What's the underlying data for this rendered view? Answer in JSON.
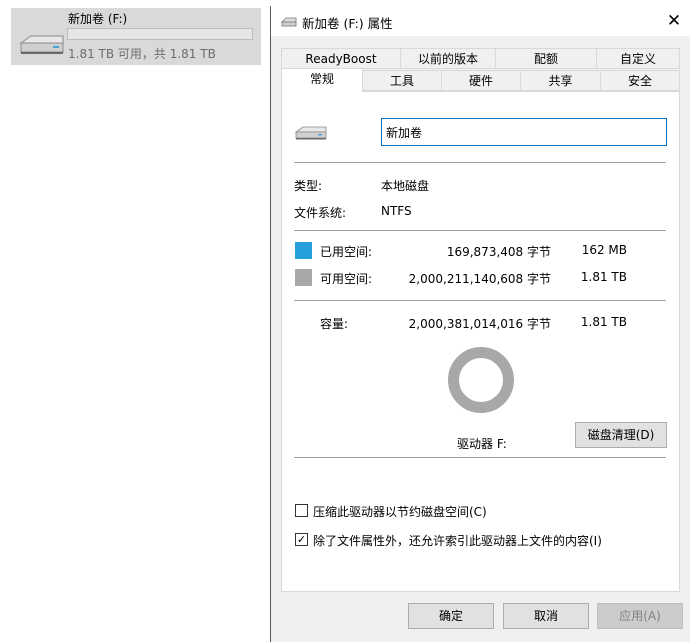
{
  "explorer": {
    "drive_name": "新加卷 (F:)",
    "drive_space": "1.81 TB 可用，共 1.81 TB",
    "usage_fraction": 0.0001
  },
  "dialog": {
    "title": "新加卷 (F:) 属性",
    "close_glyph": "✕",
    "tabs_row1": [
      "ReadyBoost",
      "以前的版本",
      "配额",
      "自定义"
    ],
    "tabs_row2": [
      "常规",
      "工具",
      "硬件",
      "共享",
      "安全"
    ],
    "active_tab": "常规",
    "volume_name_value": "新加卷",
    "type_label": "类型:",
    "type_value": "本地磁盘",
    "fs_label": "文件系统:",
    "fs_value": "NTFS",
    "used_label": "已用空间:",
    "used_bytes": "169,873,408 字节",
    "used_size": "162 MB",
    "free_label": "可用空间:",
    "free_bytes": "2,000,211,140,608 字节",
    "free_size": "1.81 TB",
    "capacity_label": "容量:",
    "capacity_bytes": "2,000,381,014,016 字节",
    "capacity_size": "1.81 TB",
    "drive_label": "驱动器 F:",
    "cleanup_button": "磁盘清理(D)",
    "compress_label": "压缩此驱动器以节约磁盘空间(C)",
    "compress_checked": false,
    "index_label": "除了文件属性外，还允许索引此驱动器上文件的内容(I)",
    "index_checked": true,
    "ok_button": "确定",
    "cancel_button": "取消",
    "apply_button": "应用(A)",
    "colors": {
      "used": "#26a0da",
      "free": "#a8a8a8",
      "accent": "#0e70c0"
    }
  }
}
